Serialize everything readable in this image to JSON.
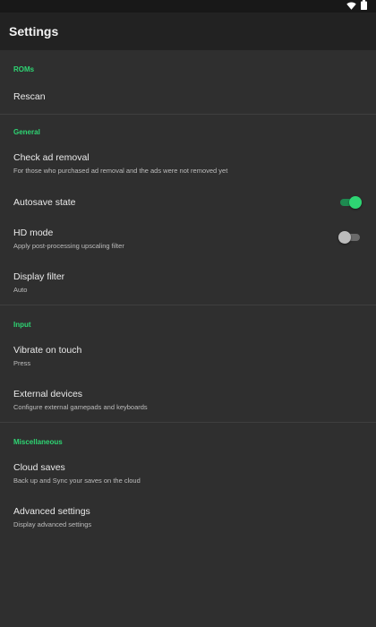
{
  "app_bar": {
    "title": "Settings"
  },
  "status_bar": {
    "icons": [
      "wifi-icon",
      "battery-icon"
    ]
  },
  "colors": {
    "accent": "#2ed573",
    "background": "#2f2f2f",
    "app_bar": "#222222"
  },
  "sections": {
    "roms": {
      "header": "ROMs",
      "rescan": {
        "title": "Rescan"
      }
    },
    "general": {
      "header": "General",
      "check_ad_removal": {
        "title": "Check ad removal",
        "summary": "For those who purchased ad removal and the ads were not removed yet"
      },
      "autosave_state": {
        "title": "Autosave state",
        "enabled": true
      },
      "hd_mode": {
        "title": "HD mode",
        "summary": "Apply post-processing upscaling filter",
        "enabled": false
      },
      "display_filter": {
        "title": "Display filter",
        "summary": "Auto"
      }
    },
    "input": {
      "header": "Input",
      "vibrate_on_touch": {
        "title": "Vibrate on touch",
        "summary": "Press"
      },
      "external_devices": {
        "title": "External devices",
        "summary": "Configure external gamepads and keyboards"
      }
    },
    "miscellaneous": {
      "header": "Miscellaneous",
      "cloud_saves": {
        "title": "Cloud saves",
        "summary": "Back up and Sync your saves on the cloud"
      },
      "advanced_settings": {
        "title": "Advanced settings",
        "summary": "Display advanced settings"
      }
    }
  }
}
